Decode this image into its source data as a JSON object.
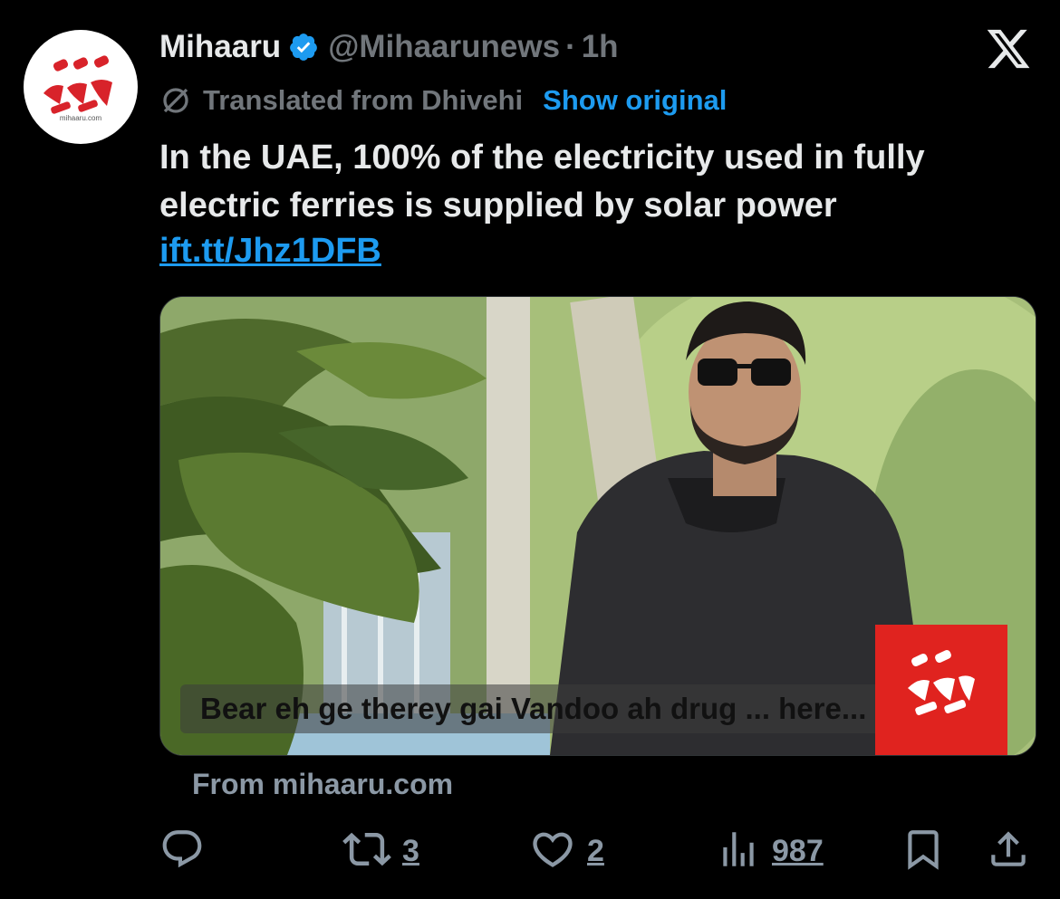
{
  "tweet": {
    "author_name": "Mihaaru",
    "handle": "@Mihaarunews",
    "separator": "·",
    "time": "1h",
    "translated_label": "Translated from Dhivehi",
    "show_original_label": "Show original",
    "text": "In the UAE, 100% of the electricity used in fully electric ferries is supplied by solar power",
    "link": "ift.tt/Jhz1DFB",
    "avatar_caption": "mihaaru.com"
  },
  "card": {
    "caption": "Bear eh ge therey gai Vandoo ah drug ... here...",
    "source": "From mihaaru.com"
  },
  "actions": {
    "reply_count": "",
    "retweet_count": "3",
    "like_count": "2",
    "views_count": "987"
  },
  "icons": {
    "verified": "verified-badge-icon",
    "translate": "translate-icon",
    "x_logo": "x-logo-icon",
    "reply": "reply-icon",
    "retweet": "retweet-icon",
    "like": "heart-icon",
    "views": "views-icon",
    "bookmark": "bookmark-icon",
    "share": "share-icon"
  },
  "colors": {
    "background": "#000000",
    "text": "#e7e9ea",
    "muted": "#71767b",
    "link": "#1d9bf0",
    "brand_red": "#e0231f"
  }
}
